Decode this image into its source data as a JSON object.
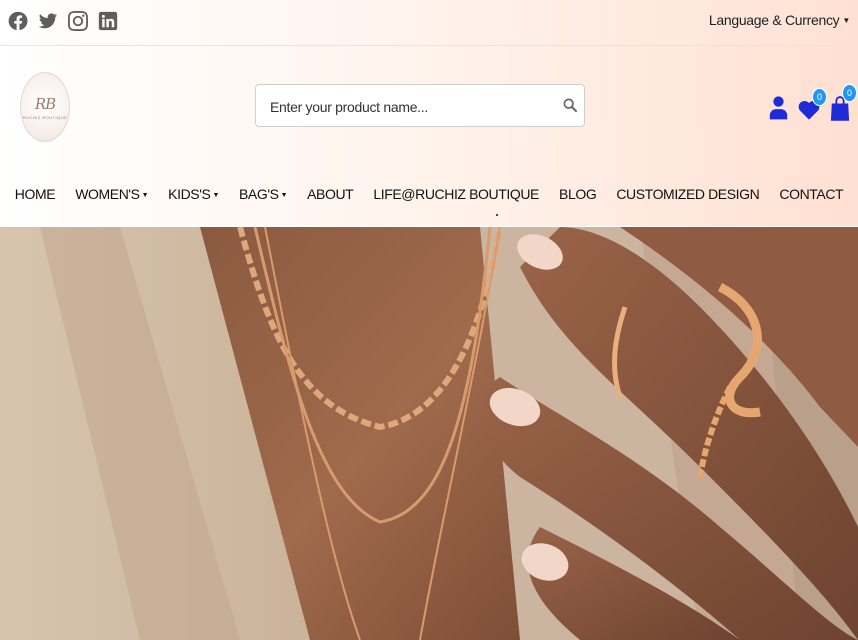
{
  "top_bar": {
    "social": [
      {
        "name": "facebook-icon"
      },
      {
        "name": "twitter-icon"
      },
      {
        "name": "instagram-icon"
      },
      {
        "name": "linkedin-icon"
      }
    ],
    "language_label": "Language & Currency"
  },
  "header": {
    "logo": {
      "monogram": "RB",
      "subtitle": "RUCHIZ BOUTIQUE"
    },
    "search": {
      "placeholder": "Enter your product name..."
    },
    "wishlist_count": "0",
    "cart_count": "0"
  },
  "nav": {
    "items": [
      {
        "label": "HOME"
      },
      {
        "label": "WOMEN'S",
        "dropdown": true
      },
      {
        "label": "KIDS'S",
        "dropdown": true
      },
      {
        "label": "BAG'S",
        "dropdown": true
      },
      {
        "label": "ABOUT"
      },
      {
        "label": "LIFE@RUCHIZ BOUTIQUE"
      },
      {
        "label": "BLOG"
      },
      {
        "label": "CUSTOMIZED DESIGN"
      },
      {
        "label": "CONTACT"
      }
    ]
  },
  "colors": {
    "icon_blue": "#1f2bd6",
    "badge_blue": "#2196f3",
    "header_peach": "#ffe0d2"
  }
}
